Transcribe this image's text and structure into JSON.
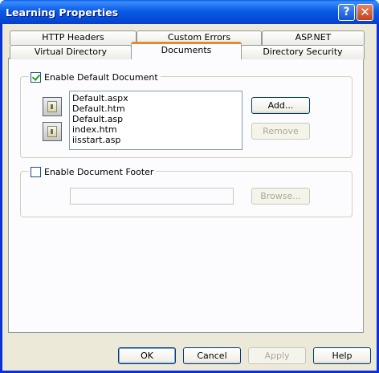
{
  "window": {
    "title": "Learning Properties",
    "help_glyph": "?",
    "close_glyph": "✕"
  },
  "tabs": {
    "back_row": [
      {
        "label": "HTTP Headers"
      },
      {
        "label": "Custom Errors"
      },
      {
        "label": "ASP.NET"
      }
    ],
    "front_row": [
      {
        "label": "Virtual Directory"
      },
      {
        "label": "Documents",
        "active": true
      },
      {
        "label": "Directory Security"
      }
    ]
  },
  "default_document": {
    "label": "Enable Default Document",
    "checked": true,
    "documents": [
      "Default.aspx",
      "Default.htm",
      "Default.asp",
      "index.htm",
      "iisstart.asp"
    ],
    "move_up_icon": "move-up-icon",
    "move_down_icon": "move-down-icon",
    "add_label": "Add...",
    "remove_label": "Remove"
  },
  "document_footer": {
    "label": "Enable Document Footer",
    "checked": false,
    "path_value": "",
    "browse_label": "Browse..."
  },
  "footer": {
    "ok_label": "OK",
    "cancel_label": "Cancel",
    "apply_label": "Apply",
    "help_label": "Help"
  },
  "colors": {
    "titlebar": "#0a5ce6",
    "dialog_bg": "#ece9d8",
    "active_tab_accent": "#e68b2c"
  }
}
